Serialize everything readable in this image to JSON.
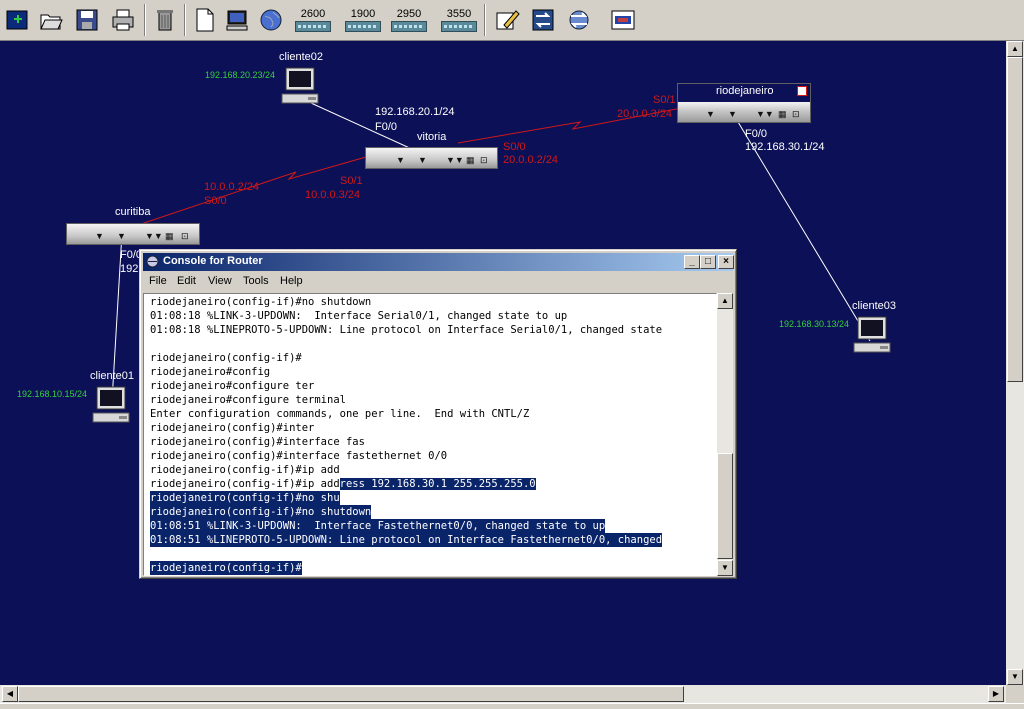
{
  "toolbar": {
    "buttons": [
      {
        "name": "new-button",
        "icon": "new-document-icon"
      },
      {
        "name": "open-button",
        "icon": "folder-open-icon"
      },
      {
        "name": "save-button",
        "icon": "floppy-disk-icon"
      },
      {
        "name": "print-button",
        "icon": "printer-icon"
      },
      {
        "name": "delete-button",
        "icon": "trash-icon"
      },
      {
        "name": "blank-page-button",
        "icon": "blank-page-icon"
      },
      {
        "name": "add-pc-button",
        "icon": "pc-icon"
      },
      {
        "name": "add-cloud-button",
        "icon": "globe-icon"
      }
    ],
    "switches": [
      "2600",
      "1900",
      "2950",
      "3550"
    ]
  },
  "network": {
    "devices": {
      "cliente02": {
        "name": "cliente02",
        "ip": "192.168.20.23/24"
      },
      "cliente01": {
        "name": "cliente01",
        "ip": "192.168.10.15/24"
      },
      "cliente03": {
        "name": "cliente03",
        "ip": "192.168.30.13/24"
      },
      "vitoria": {
        "name": "vitoria",
        "if_label": "F0/0",
        "if_ip": "192.168.20.1/24",
        "s00": "S0/0",
        "s00_ip": "20.0.0.2/24",
        "s01": "S0/1",
        "s01_ip": "10.0.0.3/24"
      },
      "curitiba": {
        "name": "curitiba",
        "s00_ip": "10.0.0.2/24",
        "s00": "S0/0",
        "f00": "F0/0",
        "f00_ip_partial": "192"
      },
      "riodejaneiro": {
        "name": "riodejaneiro",
        "s01": "S0/1",
        "s01_ip": "20.0.0.3/24",
        "f00": "F0/0",
        "f00_ip": "192.168.30.1/24"
      }
    }
  },
  "console": {
    "title": "Console for Router",
    "menu": [
      "File",
      "Edit",
      "View",
      "Tools",
      "Help"
    ],
    "lines": [
      "riodejaneiro(config-if)#no shutdown",
      "01:08:18 %LINK-3-UPDOWN:  Interface Serial0/1, changed state to up",
      "01:08:18 %LINEPROTO-5-UPDOWN: Line protocol on Interface Serial0/1, changed state",
      "",
      "riodejaneiro(config-if)#",
      "riodejaneiro#config",
      "riodejaneiro#configure ter",
      "riodejaneiro#configure terminal",
      "Enter configuration commands, one per line.  End with CNTL/Z",
      "riodejaneiro(config)#inter",
      "riodejaneiro(config)#interface fas",
      "riodejaneiro(config)#interface fastethernet 0/0",
      "riodejaneiro(config-if)#ip add",
      "riodejaneiro(config-if)#ip add",
      "riodejaneiro(config-if)#no shu",
      "riodejaneiro(config-if)#no shutdown",
      "01:08:51 %LINK-3-UPDOWN:  Interface Fastethernet0/0, changed state to up",
      "01:08:51 %LINEPROTO-5-UPDOWN: Line protocol on Interface Fastethernet0/0, changed",
      "",
      "riodejaneiro(config-if)#"
    ],
    "line13_highlight": "ress 192.168.30.1 255.255.255.0"
  }
}
